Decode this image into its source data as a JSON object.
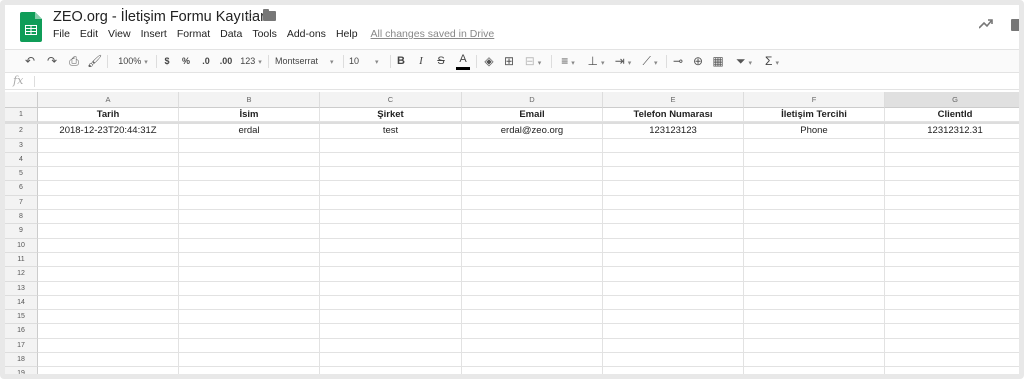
{
  "app": {
    "doc_title": "ZEO.org - İletişim Formu Kayıtları",
    "save_status": "All changes saved in Drive",
    "brand_color": "#0f9d58"
  },
  "menu": [
    "File",
    "Edit",
    "View",
    "Insert",
    "Format",
    "Data",
    "Tools",
    "Add-ons",
    "Help"
  ],
  "toolbar": {
    "zoom": "100%",
    "currency": "$",
    "percent": "%",
    "dec_decrease": ".0",
    "dec_increase": ".00",
    "more_formats": "123",
    "font": "Montserrat",
    "font_size": "10",
    "bold": "B",
    "italic": "I",
    "strike": "S",
    "text_color": "A",
    "sum": "Σ",
    "icons": [
      "undo-icon",
      "redo-icon",
      "print-icon",
      "paint-format-icon",
      "fill-color-icon",
      "borders-icon",
      "merge-icon",
      "align-icon",
      "valign-icon",
      "wrap-icon",
      "rotate-icon",
      "link-icon",
      "comment-icon",
      "chart-icon",
      "filter-icon",
      "functions-icon"
    ]
  },
  "formula_bar": {
    "fx": "fx",
    "value": ""
  },
  "columns": [
    "A",
    "B",
    "C",
    "D",
    "E",
    "F",
    "G"
  ],
  "selected_column": "G",
  "rows": [
    {
      "num": "1",
      "cells": [
        "Tarih",
        "İsim",
        "Şirket",
        "Email",
        "Telefon Numarası",
        "İletişim Tercihi",
        "ClientId"
      ]
    },
    {
      "num": "2",
      "cells": [
        "2018-12-23T20:44:31Z",
        "erdal",
        "test",
        "erdal@zeo.org",
        "123123123",
        "Phone",
        "12312312.31"
      ]
    },
    {
      "num": "3",
      "cells": [
        "",
        "",
        "",
        "",
        "",
        "",
        ""
      ]
    },
    {
      "num": "4",
      "cells": [
        "",
        "",
        "",
        "",
        "",
        "",
        ""
      ]
    },
    {
      "num": "5",
      "cells": [
        "",
        "",
        "",
        "",
        "",
        "",
        ""
      ]
    },
    {
      "num": "6",
      "cells": [
        "",
        "",
        "",
        "",
        "",
        "",
        ""
      ]
    },
    {
      "num": "7",
      "cells": [
        "",
        "",
        "",
        "",
        "",
        "",
        ""
      ]
    },
    {
      "num": "8",
      "cells": [
        "",
        "",
        "",
        "",
        "",
        "",
        ""
      ]
    },
    {
      "num": "9",
      "cells": [
        "",
        "",
        "",
        "",
        "",
        "",
        ""
      ]
    },
    {
      "num": "10",
      "cells": [
        "",
        "",
        "",
        "",
        "",
        "",
        ""
      ]
    },
    {
      "num": "11",
      "cells": [
        "",
        "",
        "",
        "",
        "",
        "",
        ""
      ]
    },
    {
      "num": "12",
      "cells": [
        "",
        "",
        "",
        "",
        "",
        "",
        ""
      ]
    },
    {
      "num": "13",
      "cells": [
        "",
        "",
        "",
        "",
        "",
        "",
        ""
      ]
    },
    {
      "num": "14",
      "cells": [
        "",
        "",
        "",
        "",
        "",
        "",
        ""
      ]
    },
    {
      "num": "15",
      "cells": [
        "",
        "",
        "",
        "",
        "",
        "",
        ""
      ]
    },
    {
      "num": "16",
      "cells": [
        "",
        "",
        "",
        "",
        "",
        "",
        ""
      ]
    },
    {
      "num": "17",
      "cells": [
        "",
        "",
        "",
        "",
        "",
        "",
        ""
      ]
    },
    {
      "num": "18",
      "cells": [
        "",
        "",
        "",
        "",
        "",
        "",
        ""
      ]
    },
    {
      "num": "19",
      "cells": [
        "",
        "",
        "",
        "",
        "",
        "",
        ""
      ]
    }
  ]
}
